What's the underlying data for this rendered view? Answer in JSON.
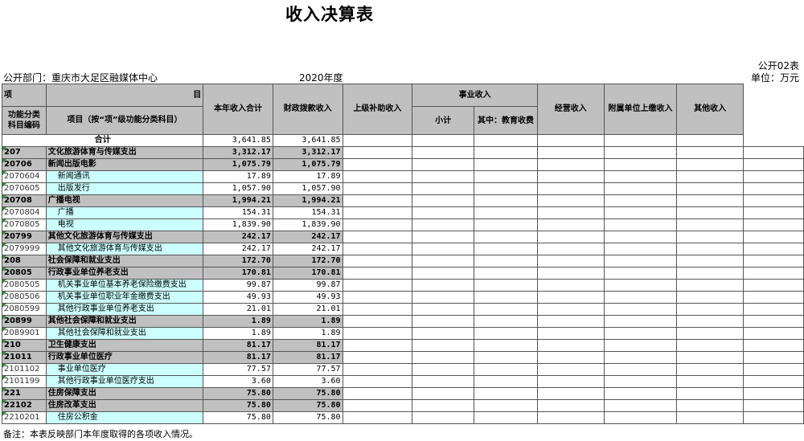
{
  "title": "收入决算表",
  "form_no": "公开02表",
  "department": "公开部门：重庆市大足区融媒体中心",
  "year": "2020年度",
  "unit": "单位：万元",
  "note": "备注：本表反映部门本年度取得的各项收入情况。",
  "header": {
    "xiang": "项",
    "mu": "目",
    "code": "功能分类科目编码",
    "item": "项目（按“项”级功能分类科目）",
    "total_income": "本年收入合计",
    "fiscal": "财政拨款收入",
    "superior": "上级补助收入",
    "business": "事业收入",
    "subtotal": "小计",
    "education": "其中：教育收费",
    "operating": "经营收入",
    "affiliated": "附属单位上缴收入",
    "other": "其他收入"
  },
  "total": {
    "label": "合计",
    "amount": "3,641.85",
    "fiscal": "3,641.85"
  },
  "rows": [
    {
      "level": 1,
      "code": "207",
      "name": "文化旅游体育与传媒支出",
      "amount": "3,312.17",
      "fiscal": "3,312.17"
    },
    {
      "level": 2,
      "code": "20706",
      "name": "新闻出版电影",
      "amount": "1,075.79",
      "fiscal": "1,075.79"
    },
    {
      "level": 3,
      "code": "2070604",
      "name": "新闻通讯",
      "amount": "17.89",
      "fiscal": "17.89"
    },
    {
      "level": 3,
      "code": "2070605",
      "name": "出版发行",
      "amount": "1,057.90",
      "fiscal": "1,057.90"
    },
    {
      "level": 2,
      "code": "20708",
      "name": "广播电视",
      "amount": "1,994.21",
      "fiscal": "1,994.21"
    },
    {
      "level": 3,
      "code": "2070804",
      "name": "广播",
      "amount": "154.31",
      "fiscal": "154.31"
    },
    {
      "level": 3,
      "code": "2070805",
      "name": "电视",
      "amount": "1,839.90",
      "fiscal": "1,839.90"
    },
    {
      "level": 2,
      "code": "20799",
      "name": "其他文化旅游体育与传媒支出",
      "amount": "242.17",
      "fiscal": "242.17"
    },
    {
      "level": 3,
      "code": "2079999",
      "name": "其他文化旅游体育与传媒支出",
      "amount": "242.17",
      "fiscal": "242.17"
    },
    {
      "level": 1,
      "code": "208",
      "name": "社会保障和就业支出",
      "amount": "172.70",
      "fiscal": "172.70"
    },
    {
      "level": 2,
      "code": "20805",
      "name": "行政事业单位养老支出",
      "amount": "170.81",
      "fiscal": "170.81"
    },
    {
      "level": 3,
      "code": "2080505",
      "name": "机关事业单位基本养老保险缴费支出",
      "amount": "99.87",
      "fiscal": "99.87"
    },
    {
      "level": 3,
      "code": "2080506",
      "name": "机关事业单位职业年金缴费支出",
      "amount": "49.93",
      "fiscal": "49.93"
    },
    {
      "level": 3,
      "code": "2080599",
      "name": "其他行政事业单位养老支出",
      "amount": "21.01",
      "fiscal": "21.01"
    },
    {
      "level": 2,
      "code": "20899",
      "name": "其他社会保障和就业支出",
      "amount": "1.89",
      "fiscal": "1.89"
    },
    {
      "level": 3,
      "code": "2089901",
      "name": "其他社会保障和就业支出",
      "amount": "1.89",
      "fiscal": "1.89"
    },
    {
      "level": 1,
      "code": "210",
      "name": "卫生健康支出",
      "amount": "81.17",
      "fiscal": "81.17"
    },
    {
      "level": 2,
      "code": "21011",
      "name": "行政事业单位医疗",
      "amount": "81.17",
      "fiscal": "81.17"
    },
    {
      "level": 3,
      "code": "2101102",
      "name": "事业单位医疗",
      "amount": "77.57",
      "fiscal": "77.57"
    },
    {
      "level": 3,
      "code": "2101199",
      "name": "其他行政事业单位医疗支出",
      "amount": "3.60",
      "fiscal": "3.60"
    },
    {
      "level": 1,
      "code": "221",
      "name": "住房保障支出",
      "amount": "75.80",
      "fiscal": "75.80"
    },
    {
      "level": 2,
      "code": "22102",
      "name": "住房改革支出",
      "amount": "75.80",
      "fiscal": "75.80"
    },
    {
      "level": 3,
      "code": "2210201",
      "name": "住房公积金",
      "amount": "75.80",
      "fiscal": "75.80"
    }
  ]
}
